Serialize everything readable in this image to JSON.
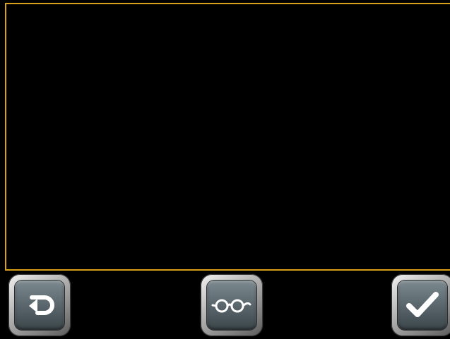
{
  "screen": {
    "title": "",
    "background_color": "#000000",
    "accent_color": "#d9a21a"
  },
  "toolbar": {
    "buttons": [
      {
        "id": "back",
        "icon": "return-arrow-icon"
      },
      {
        "id": "view",
        "icon": "glasses-icon"
      },
      {
        "id": "confirm",
        "icon": "checkmark-icon"
      }
    ]
  }
}
